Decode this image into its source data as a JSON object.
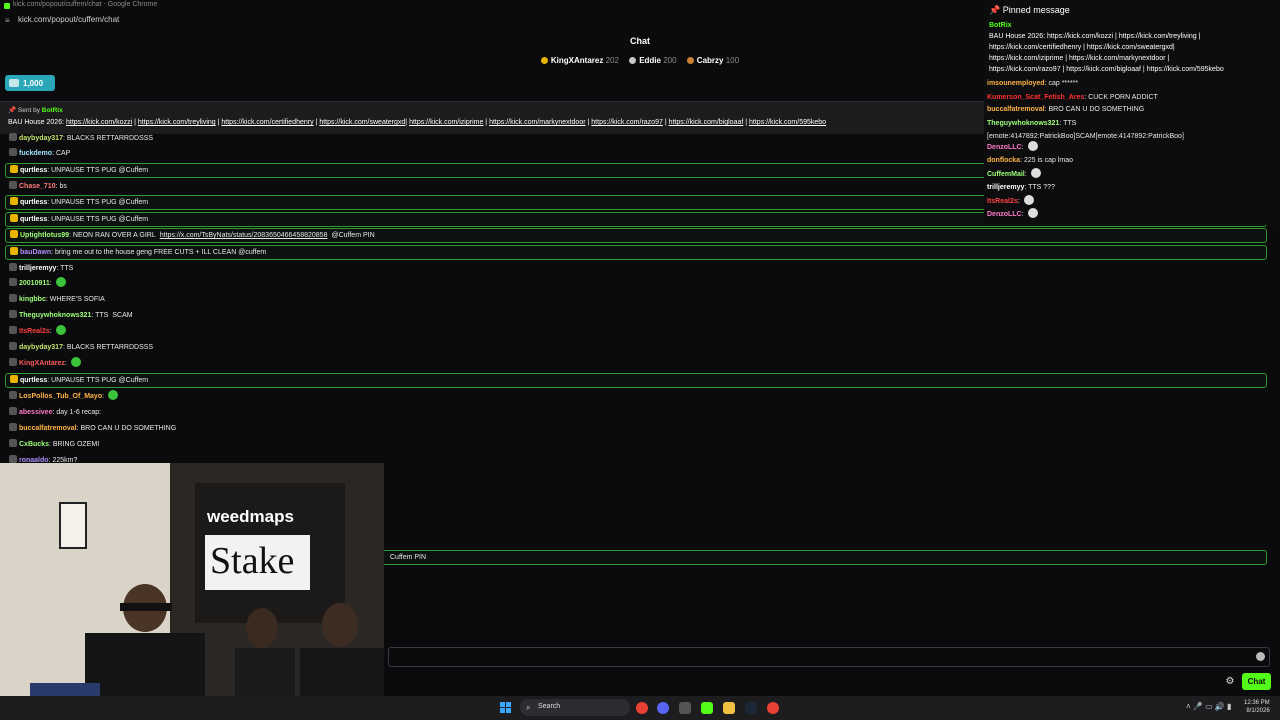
{
  "browser": {
    "title": "kick.com/popout/cuffem/chat - Google Chrome",
    "url": "kick.com/popout/cuffem/chat"
  },
  "chat": {
    "header": "Chat",
    "leaders": [
      {
        "name": "KingXAntarez",
        "points": "202",
        "color": "#e9b400"
      },
      {
        "name": "Eddie",
        "points": "200",
        "color": "#c9c9c9"
      },
      {
        "name": "Cabrzy",
        "points": "100",
        "color": "#cd7f32"
      }
    ],
    "goal": "1,000",
    "pinned_bar": {
      "sent_by_label": "Sent by",
      "sent_by_user": "BotRix",
      "text_prefix": "BAU House 2026:",
      "links": [
        "https://kick.com/kozzi",
        "https://kick.com/treyliving",
        "https://kick.com/certifiedhenry",
        "https://kick.com/sweatergxd",
        "https://kick.com/iziprime",
        "https://kick.com/markynextdoor",
        "https://kick.com/razo97",
        "https://kick.com/bigloaaf",
        "https://kick.com/595kebo"
      ]
    },
    "messages": [
      {
        "user": "daybyday317",
        "color": "#c4e36b",
        "text": "BLACKS RETTARRDDSSS",
        "hl": false
      },
      {
        "user": "fuckdemo",
        "color": "#9fe3ff",
        "text": "CAP",
        "hl": false
      },
      {
        "user": "qurtless",
        "color": "#ffffff",
        "text": "UNPAUSE TTS PUG @Cuffem",
        "hl": true
      },
      {
        "user": "Chase_710",
        "color": "#ff7a7a",
        "text": "bs",
        "hl": false
      },
      {
        "user": "qurtless",
        "color": "#ffffff",
        "text": "UNPAUSE TTS PUG @Cuffem",
        "hl": true
      },
      {
        "user": "qurtless",
        "color": "#ffffff",
        "text": "UNPAUSE TTS PUG @Cuffem",
        "hl": true
      },
      {
        "user": "Uptightlotus99",
        "color": "#9fff7a",
        "text": "NEON RAN OVER A GIRL",
        "link": "https://x.com/TsByNats/status/2083650466458820858",
        "after": "@Cuffem PIN",
        "hl": true
      },
      {
        "user": "bauDawn",
        "color": "#b08cff",
        "text": "bring me out to the house geng FREE CUTS + ILL CLEAN @cuffem",
        "hl": true
      },
      {
        "user": "trilljeremyy",
        "color": "#ffffff",
        "text": "TTS",
        "hl": false
      },
      {
        "user": "20010911",
        "color": "#9fff7a",
        "text": "",
        "hl": false
      },
      {
        "user": "kingbbc",
        "color": "#9fff7a",
        "text": "WHERE'S SOFIA",
        "hl": false
      },
      {
        "user": "Theguywhoknows321",
        "color": "#9fff7a",
        "text": "TTS",
        "after": "SCAM",
        "hl": false
      },
      {
        "user": "ItsReal2s",
        "color": "#ff4040",
        "text": "",
        "hl": false
      },
      {
        "user": "daybyday317",
        "color": "#c4e36b",
        "text": "BLACKS RETTARRDDSSS",
        "hl": false
      },
      {
        "user": "KingXAntarez",
        "color": "#ff5a5a",
        "text": "",
        "hl": false
      },
      {
        "user": "qurtless",
        "color": "#ffffff",
        "text": "UNPAUSE TTS PUG @Cuffem",
        "hl": true
      },
      {
        "user": "LosPollos_Tub_Of_Mayo",
        "color": "#ffb347",
        "text": "",
        "hl": false
      },
      {
        "user": "abessivee",
        "color": "#ff7ac8",
        "text": "day 1-6 recap:",
        "hl": false
      },
      {
        "user": "buccalfatremoval",
        "color": "#ffb347",
        "text": "BRO CAN U DO SOMETHING",
        "hl": false
      },
      {
        "user": "CxBucks",
        "color": "#9fff7a",
        "text": "BRING OZEMI",
        "hl": false
      },
      {
        "user": "ronaaldo",
        "color": "#b08cff",
        "text": "225km?",
        "hl": false
      }
    ],
    "lower_highlight_text": "Cuffem PIN",
    "input_placeholder": "",
    "send_label": "Chat"
  },
  "video_overlay": {
    "brand1": "weedmaps",
    "brand2": "Stake"
  },
  "pinned_panel": {
    "title": "Pinned message",
    "user": "BotRix",
    "lines": [
      "BAU House 2026: https://kick.com/kozzi | https://kick.com/treyliving |",
      "https://kick.com/certifiedhenry | https://kick.com/sweatergxd|",
      "https://kick.com/iziprime | https://kick.com/markynextdoor |",
      "https://kick.com/razo97 | https://kick.com/bigloaaf | https://kick.com/595kebo"
    ],
    "messages": [
      {
        "user": "imsounemployed",
        "color": "#ffb347",
        "text": "cap ******"
      },
      {
        "user": "Kumerson_Scat_Fetish_Ares",
        "color": "#ff3030",
        "text": "CUCK PORN ADDICT"
      },
      {
        "user": "buccalfatremoval",
        "color": "#ffb347",
        "text": "BRO CAN U DO SOMETHING"
      },
      {
        "user": "Theguywhoknows321",
        "color": "#9fff7a",
        "text": "TTS [emote:4147892:PatrickBoo]SCAM[emote:4147892:PatrickBoo]"
      },
      {
        "user": "DenzoLLC",
        "color": "#ff7ac8",
        "text": ""
      },
      {
        "user": "donflocka",
        "color": "#ffb347",
        "text": "225 is cap lmao"
      },
      {
        "user": "CuffemMail",
        "color": "#9fff7a",
        "text": ""
      },
      {
        "user": "trilljeremyy",
        "color": "#ffffff",
        "text": "TTS ???"
      },
      {
        "user": "ItsReal2s",
        "color": "#ff4040",
        "text": ""
      },
      {
        "user": "DenzoLLC",
        "color": "#ff7ac8",
        "text": ""
      }
    ]
  },
  "taskbar": {
    "search_label": "Search",
    "time": "12:36 PM",
    "date": "8/1/2026"
  }
}
